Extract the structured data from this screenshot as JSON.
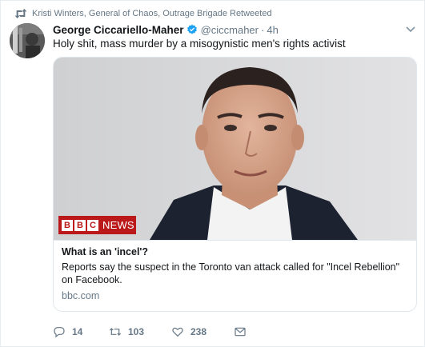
{
  "retweet_context": {
    "text": "Kristi Winters, General of Chaos, Outrage Brigade Retweeted"
  },
  "tweet": {
    "author": {
      "display_name": "George Ciccariello-Maher",
      "handle": "@ciccmaher",
      "verified": true
    },
    "separator": "·",
    "time": "4h",
    "text": "Holy shit, mass murder by a misogynistic men's rights activist"
  },
  "card": {
    "badge": {
      "letters": [
        "B",
        "B",
        "C"
      ],
      "news": "NEWS"
    },
    "title": "What is an 'incel'?",
    "description": "Reports say the suspect in the Toronto van attack called for \"Incel Rebellion\" on Facebook.",
    "domain": "bbc.com"
  },
  "actions": {
    "replies": "14",
    "retweets": "103",
    "likes": "238"
  },
  "colors": {
    "brand_blue": "#1da1f2",
    "secondary_text": "#657786",
    "bbc_red": "#bb1919"
  },
  "icons": [
    "retweet-icon",
    "verified-badge-icon",
    "caret-down-icon",
    "reply-icon",
    "retweet-icon",
    "heart-icon",
    "envelope-icon"
  ]
}
